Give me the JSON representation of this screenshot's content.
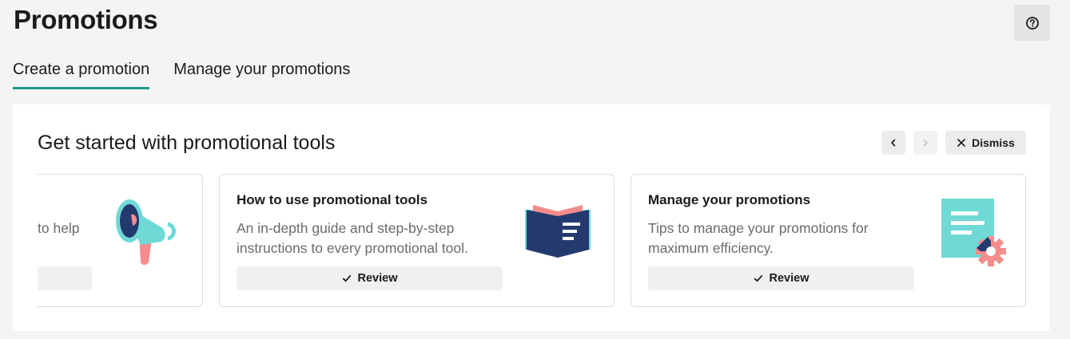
{
  "header": {
    "title": "Promotions",
    "help_icon": "question-circle-icon"
  },
  "tabs": [
    {
      "label": "Create a promotion",
      "active": true
    },
    {
      "label": "Manage your promotions",
      "active": false
    }
  ],
  "panel": {
    "title": "Get started with promotional tools",
    "prev_icon": "chevron-left-icon",
    "next_icon": "chevron-right-icon",
    "next_disabled": true,
    "dismiss_label": "Dismiss",
    "cards": [
      {
        "title": "",
        "description": "to help",
        "button_label": "",
        "illustration": "megaphone-icon"
      },
      {
        "title": "How to use promotional tools",
        "description": "An in-depth guide and step-by-step instructions to every promotional tool.",
        "button_label": "Review",
        "illustration": "book-icon"
      },
      {
        "title": "Manage your promotions",
        "description": "Tips to manage your promotions for maximum efficiency.",
        "button_label": "Review",
        "illustration": "document-gear-icon"
      }
    ]
  },
  "colors": {
    "accent_teal": "#1a9a8c",
    "illus_teal": "#6fd9d6",
    "illus_navy": "#233a6e",
    "illus_pink": "#f48c8c"
  }
}
